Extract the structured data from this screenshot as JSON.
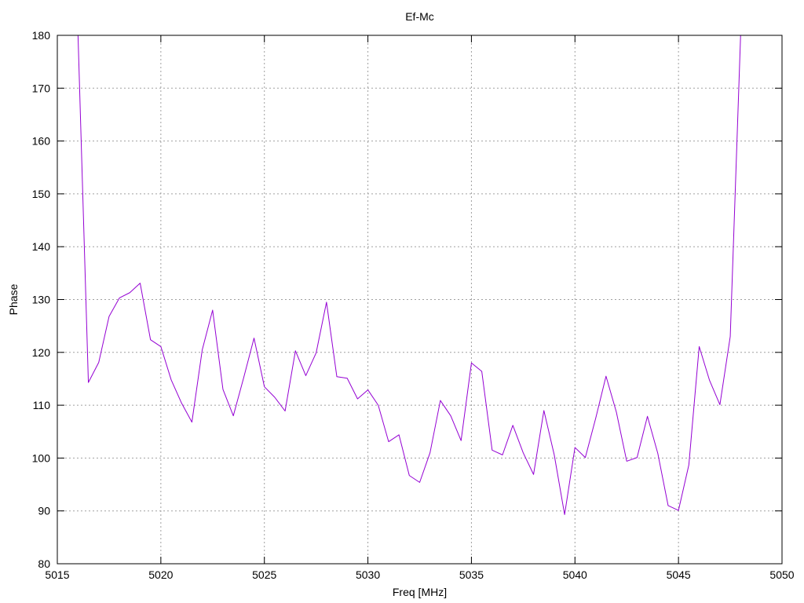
{
  "chart_data": {
    "type": "line",
    "title": "Ef-Mc",
    "xlabel": "Freq [MHz]",
    "ylabel": "Phase",
    "xlim": [
      5015,
      5050
    ],
    "ylim": [
      80,
      180
    ],
    "xticks": [
      5015,
      5020,
      5025,
      5030,
      5035,
      5040,
      5045,
      5050
    ],
    "yticks": [
      80,
      90,
      100,
      110,
      120,
      130,
      140,
      150,
      160,
      170,
      180
    ],
    "grid": true,
    "line_color": "#9400d3",
    "series": [
      {
        "x": [
          5016,
          5016.5,
          5017,
          5017.5,
          5018,
          5018.5,
          5019,
          5019.5,
          5020,
          5020.5,
          5021,
          5021.5,
          5022,
          5022.5,
          5023,
          5023.5,
          5024,
          5024.5,
          5025,
          5025.5,
          5026,
          5026.5,
          5027,
          5027.5,
          5028,
          5028.5,
          5029,
          5029.5,
          5030,
          5030.5,
          5031,
          5031.5,
          5032,
          5032.5,
          5033,
          5033.5,
          5034,
          5034.5,
          5035,
          5035.5,
          5036,
          5036.5,
          5037,
          5037.5,
          5038,
          5038.5,
          5039,
          5039.5,
          5040,
          5040.5,
          5041,
          5041.5,
          5042,
          5042.5,
          5043,
          5043.5,
          5044,
          5044.5,
          5045,
          5045.5,
          5046,
          5046.5,
          5047,
          5047.5,
          5048
        ],
        "y": [
          180,
          114.3,
          118.1,
          126.8,
          130.3,
          131.3,
          133.1,
          122.4,
          121.1,
          114.8,
          110.4,
          106.8,
          120.5,
          128.0,
          113.0,
          108.0,
          115.2,
          122.7,
          113.5,
          111.5,
          108.9,
          120.3,
          115.6,
          119.9,
          129.5,
          115.4,
          115.1,
          111.2,
          112.9,
          110.0,
          103.1,
          104.4,
          96.7,
          95.4,
          101.0,
          110.9,
          108.0,
          103.3,
          118.0,
          116.4,
          101.5,
          100.6,
          106.2,
          101.0,
          96.9,
          109.0,
          100.6,
          89.3,
          102.0,
          100.1,
          107.5,
          115.5,
          108.7,
          99.4,
          100.1,
          107.9,
          100.9,
          91.0,
          90.1,
          98.7,
          121.1,
          114.7,
          110.1,
          123.0,
          180
        ]
      }
    ]
  }
}
